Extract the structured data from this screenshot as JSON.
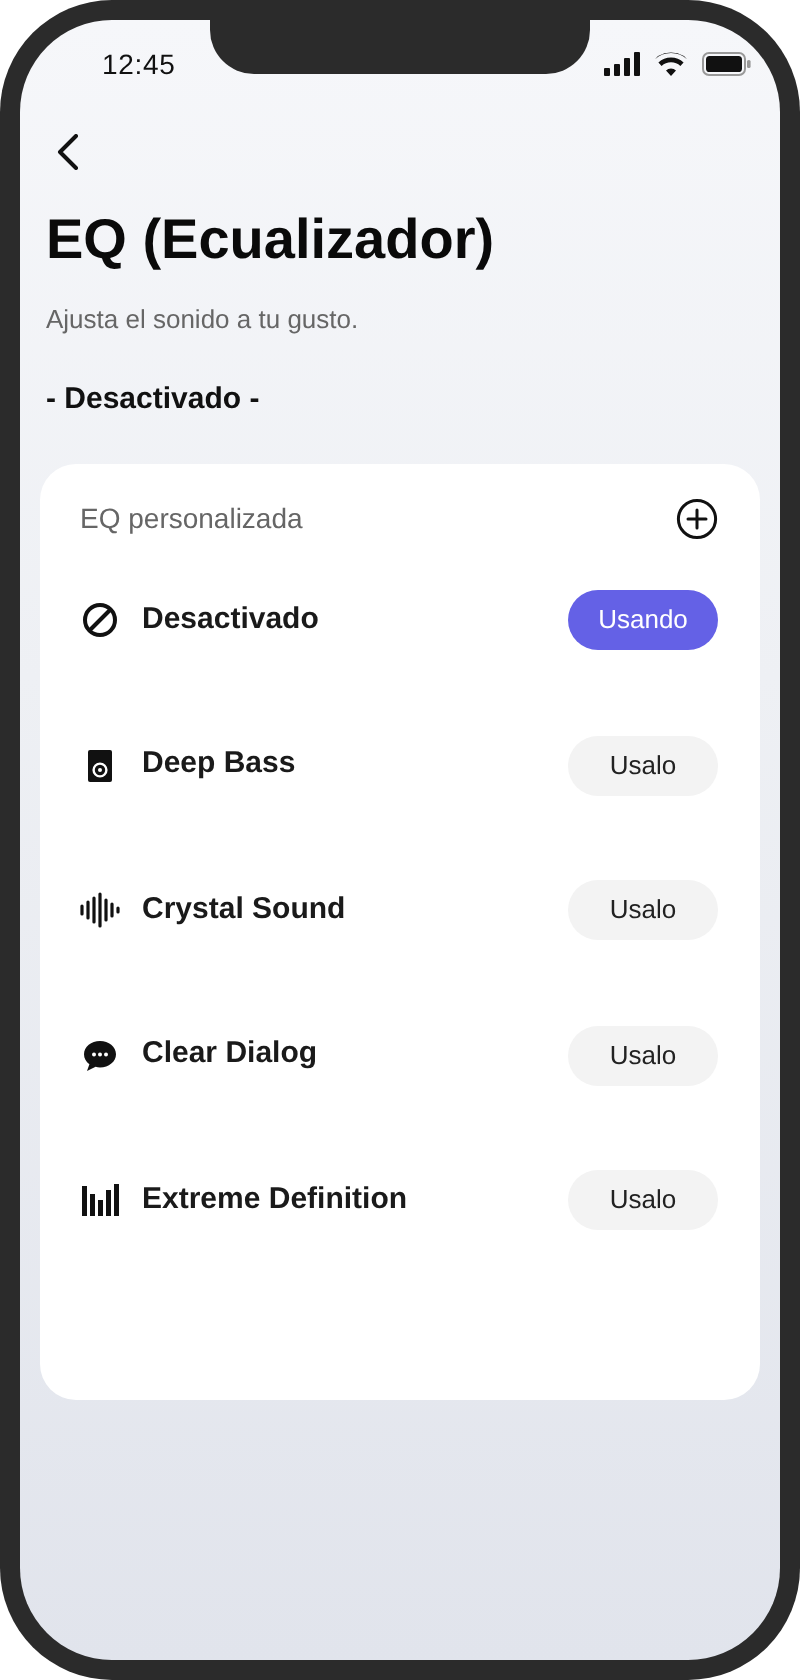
{
  "status_bar": {
    "time": "12:45"
  },
  "header": {
    "title": "EQ (Ecualizador)",
    "subtitle": "Ajusta el sonido a tu gusto.",
    "current": "- Desactivado -"
  },
  "card": {
    "title": "EQ personalizada",
    "presets": [
      {
        "name": "Desactivado",
        "selected": true,
        "button": "Usando"
      },
      {
        "name": "Deep Bass",
        "selected": false,
        "button": "Usalo"
      },
      {
        "name": "Crystal Sound",
        "selected": false,
        "button": "Usalo"
      },
      {
        "name": "Clear Dialog",
        "selected": false,
        "button": "Usalo"
      },
      {
        "name": "Extreme Definition",
        "selected": false,
        "button": "Usalo"
      }
    ]
  }
}
